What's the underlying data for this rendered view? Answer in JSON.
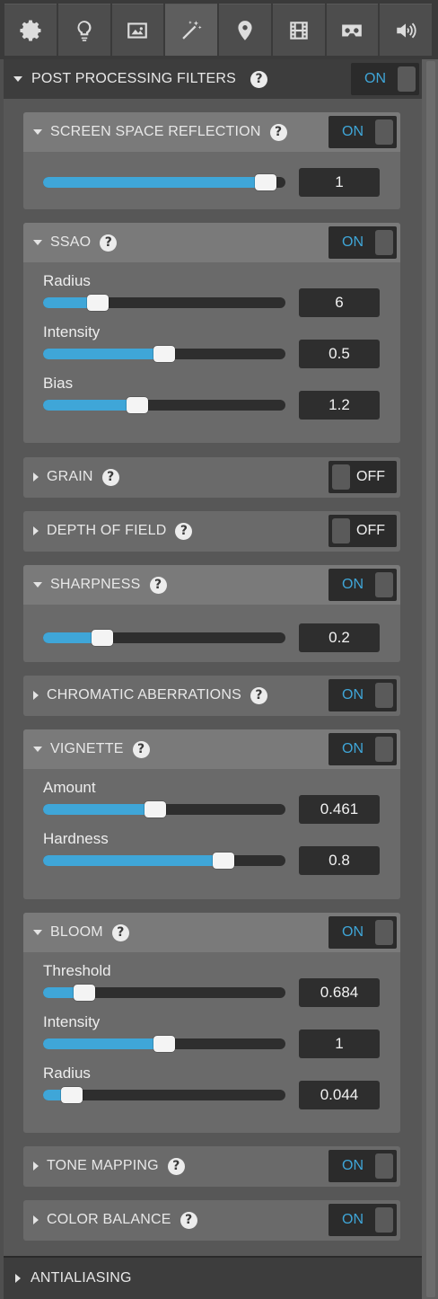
{
  "toolbar": {
    "icons": [
      "gear-icon",
      "lightbulb-icon",
      "image-icon",
      "magic-wand-icon",
      "map-pin-icon",
      "film-icon",
      "vr-headset-icon",
      "speaker-icon"
    ],
    "active": "magic-wand-icon"
  },
  "header": {
    "title": "POST PROCESSING FILTERS",
    "toggle": "ON"
  },
  "footer": {
    "title": "ANTIALIASING"
  },
  "colors": {
    "accent": "#3fa6d8",
    "panel": "#575757",
    "card": "#6a6a6a",
    "dark": "#2e2e2e"
  },
  "sections": [
    {
      "title": "SCREEN SPACE REFLECTION",
      "expanded": true,
      "toggle": "ON",
      "params": [
        {
          "label": "",
          "value": "1",
          "fraction": 0.96
        }
      ]
    },
    {
      "title": "SSAO",
      "expanded": true,
      "toggle": "ON",
      "params": [
        {
          "label": "Radius",
          "value": "6",
          "fraction": 0.2
        },
        {
          "label": "Intensity",
          "value": "0.5",
          "fraction": 0.5
        },
        {
          "label": "Bias",
          "value": "1.2",
          "fraction": 0.38
        }
      ]
    },
    {
      "title": "GRAIN",
      "expanded": false,
      "toggle": "OFF",
      "params": []
    },
    {
      "title": "DEPTH OF FIELD",
      "expanded": false,
      "toggle": "OFF",
      "params": []
    },
    {
      "title": "SHARPNESS",
      "expanded": true,
      "toggle": "ON",
      "params": [
        {
          "label": "",
          "value": "0.2",
          "fraction": 0.22
        }
      ]
    },
    {
      "title": "CHROMATIC ABERRATIONS",
      "expanded": false,
      "toggle": "ON",
      "params": []
    },
    {
      "title": "VIGNETTE",
      "expanded": true,
      "toggle": "ON",
      "params": [
        {
          "label": "Amount",
          "value": "0.461",
          "fraction": 0.46
        },
        {
          "label": "Hardness",
          "value": "0.8",
          "fraction": 0.77
        }
      ]
    },
    {
      "title": "BLOOM",
      "expanded": true,
      "toggle": "ON",
      "params": [
        {
          "label": "Threshold",
          "value": "0.684",
          "fraction": 0.14
        },
        {
          "label": "Intensity",
          "value": "1",
          "fraction": 0.5
        },
        {
          "label": "Radius",
          "value": "0.044",
          "fraction": 0.08
        }
      ]
    },
    {
      "title": "TONE MAPPING",
      "expanded": false,
      "toggle": "ON",
      "params": []
    },
    {
      "title": "COLOR BALANCE",
      "expanded": false,
      "toggle": "ON",
      "params": []
    }
  ]
}
